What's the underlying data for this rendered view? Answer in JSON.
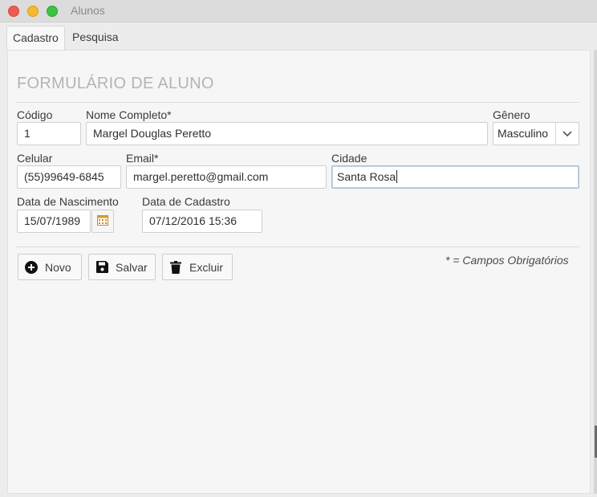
{
  "window": {
    "title": "Alunos"
  },
  "tabs": [
    {
      "label": "Cadastro",
      "active": true
    },
    {
      "label": "Pesquisa",
      "active": false
    }
  ],
  "form": {
    "title": "FORMULÁRIO DE ALUNO",
    "codigo": {
      "label": "Código",
      "value": "1"
    },
    "nome": {
      "label": "Nome Completo*",
      "value": "Margel Douglas Peretto"
    },
    "genero": {
      "label": "Gênero",
      "value": "Masculino"
    },
    "celular": {
      "label": "Celular",
      "value": "(55)99649-6845"
    },
    "email": {
      "label": "Email*",
      "value": "margel.peretto@gmail.com"
    },
    "cidade": {
      "label": "Cidade",
      "value": "Santa Rosa"
    },
    "nascimento": {
      "label": "Data de Nascimento",
      "value": "15/07/1989"
    },
    "cadastro": {
      "label": "Data de Cadastro",
      "value": "07/12/2016 15:36"
    }
  },
  "actions": {
    "novo": "Novo",
    "salvar": "Salvar",
    "excluir": "Excluir"
  },
  "required_note": "* = Campos Obrigatórios",
  "colors": {
    "close": "#ee5a52",
    "minimize": "#f5b82f",
    "maximize": "#3ec145",
    "title_gray": "#b4b4b4"
  },
  "icons": {
    "novo": "plus-circle-icon",
    "salvar": "floppy-disk-icon",
    "excluir": "trash-icon",
    "calendar": "calendar-icon",
    "select": "chevron-down-icon"
  }
}
